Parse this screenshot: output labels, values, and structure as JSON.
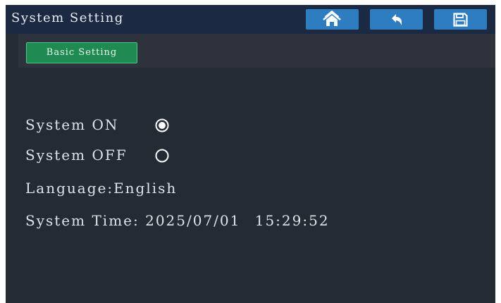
{
  "header": {
    "title": "System Setting",
    "icons": {
      "home": "home-icon",
      "back": "back-arrow-icon",
      "save": "save-icon"
    }
  },
  "tabs": [
    {
      "label": "Basic Setting",
      "active": true
    }
  ],
  "system_power": {
    "on_label": "System ON",
    "off_label": "System OFF",
    "selected": "on"
  },
  "language": {
    "label": "Language:",
    "value": "English"
  },
  "system_time": {
    "label": "System Time:",
    "date": "2025/07/01",
    "time": "15:29:52"
  },
  "colors": {
    "header_bg": "#1b2a42",
    "screen_bg": "#252b35",
    "button_blue": "#2f7dc1",
    "tab_green": "#1f8a52"
  }
}
